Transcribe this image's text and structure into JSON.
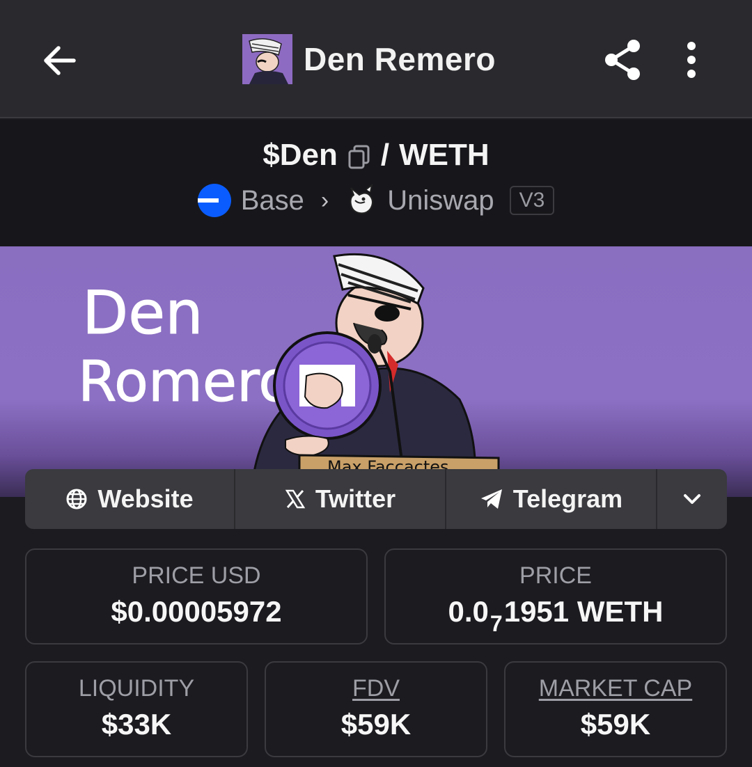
{
  "appbar": {
    "title": "Den Remero"
  },
  "pair": {
    "base_token": "$Den",
    "separator": "/",
    "quote_token": "WETH",
    "chain": "Base",
    "dex": "Uniswap",
    "version": "V3"
  },
  "banner": {
    "text_line1": "Den",
    "text_line2": "Romero",
    "podium_text": "Max Faccactes"
  },
  "links": [
    {
      "label": "Website",
      "icon": "globe-icon"
    },
    {
      "label": "Twitter",
      "icon": "x-icon"
    },
    {
      "label": "Telegram",
      "icon": "telegram-icon"
    }
  ],
  "stats": {
    "price_usd_label": "PRICE USD",
    "price_usd_value": "$0.00005972",
    "price_label": "PRICE",
    "price_prefix": "0.0",
    "price_sub": "7",
    "price_suffix": "1951 WETH",
    "liquidity_label": "LIQUIDITY",
    "liquidity_value": "$33K",
    "fdv_label": "FDV",
    "fdv_value": "$59K",
    "mcap_label": "MARKET CAP",
    "mcap_value": "$59K"
  },
  "colors": {
    "background": "#1b1b20",
    "appbar": "#2a2a2e",
    "banner_purple": "#8c70c4",
    "base_blue": "#0a5cff"
  }
}
